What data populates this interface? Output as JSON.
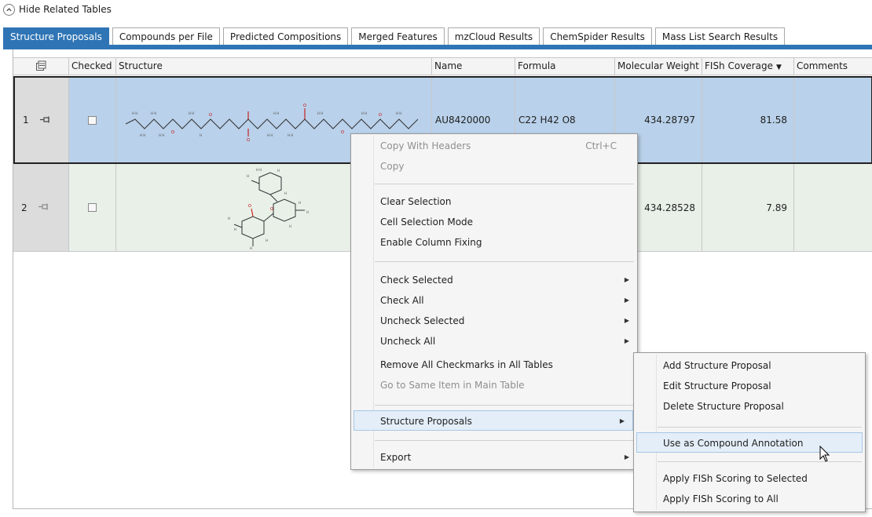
{
  "toggle": {
    "label": "Hide Related Tables"
  },
  "tabs": [
    {
      "label": "Structure Proposals",
      "active": true
    },
    {
      "label": "Compounds per File"
    },
    {
      "label": "Predicted Compositions"
    },
    {
      "label": "Merged Features"
    },
    {
      "label": "mzCloud Results"
    },
    {
      "label": "ChemSpider Results"
    },
    {
      "label": "Mass List Search Results"
    }
  ],
  "columns": {
    "checked": "Checked",
    "structure": "Structure",
    "name": "Name",
    "formula": "Formula",
    "mw": "Molecular Weight",
    "fish": "FISh Coverage",
    "comments": "Comments"
  },
  "rows": [
    {
      "num": "1",
      "name": "AU8420000",
      "formula": "C22 H42 O8",
      "mw": "434.28797",
      "fish": "81.58"
    },
    {
      "num": "2",
      "name": "",
      "formula": "",
      "mw": "434.28528",
      "fish": "7.89"
    }
  ],
  "menu": {
    "copy_headers": "Copy With Headers",
    "copy_headers_shortcut": "Ctrl+C",
    "copy": "Copy",
    "clear_selection": "Clear Selection",
    "cell_selection": "Cell Selection Mode",
    "enable_fixing": "Enable Column Fixing",
    "check_selected": "Check Selected",
    "check_all": "Check All",
    "uncheck_selected": "Uncheck Selected",
    "uncheck_all": "Uncheck All",
    "remove_checkmarks": "Remove All Checkmarks in All Tables",
    "go_to_same": "Go to Same Item in Main Table",
    "structure_proposals": "Structure Proposals",
    "export": "Export"
  },
  "submenu": {
    "add": "Add Structure Proposal",
    "edit": "Edit Structure Proposal",
    "delete": "Delete Structure Proposal",
    "use_as": "Use as Compound Annotation",
    "apply_selected": "Apply FISh Scoring to Selected",
    "apply_all": "Apply FISh Scoring to All"
  },
  "colors": {
    "accent": "#2f75b5",
    "selected_row": "#b9d1ea",
    "row2": "#e8f0e8",
    "menu_highlight": "#e4eef8"
  }
}
